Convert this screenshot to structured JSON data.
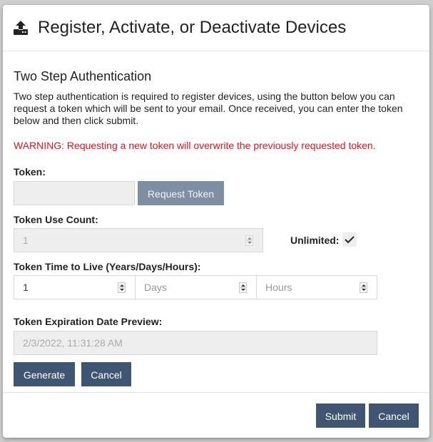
{
  "modal": {
    "title": "Register, Activate, or Deactivate Devices",
    "header_icon": "upload-device-icon"
  },
  "section": {
    "title": "Two Step Authentication",
    "description": "Two step authentication is required to register devices, using the button below you can request a token which will be sent to your email. Once received, you can enter the token below and then click submit.",
    "warning": "WARNING: Requesting a new token will overwrite the previously requested token.",
    "warning_color": "#e8121b"
  },
  "token": {
    "label": "Token:",
    "value": "",
    "request_button": "Request Token"
  },
  "use_count": {
    "label": "Token Use Count:",
    "value": "1",
    "unlimited_label": "Unlimited:",
    "unlimited_checked": true
  },
  "ttl": {
    "label": "Token Time to Live (Years/Days/Hours):",
    "years_value": "1",
    "days_placeholder": "Days",
    "hours_placeholder": "Hours"
  },
  "expiration": {
    "label": "Token Expiration Date Preview:",
    "value": "2/3/2022, 11:31:28 AM"
  },
  "actions": {
    "generate": "Generate",
    "cancel": "Cancel"
  },
  "footer": {
    "submit": "Submit",
    "cancel": "Cancel"
  },
  "colors": {
    "primary_button": "#3e5671",
    "disabled_button": "#7f8fa3"
  }
}
